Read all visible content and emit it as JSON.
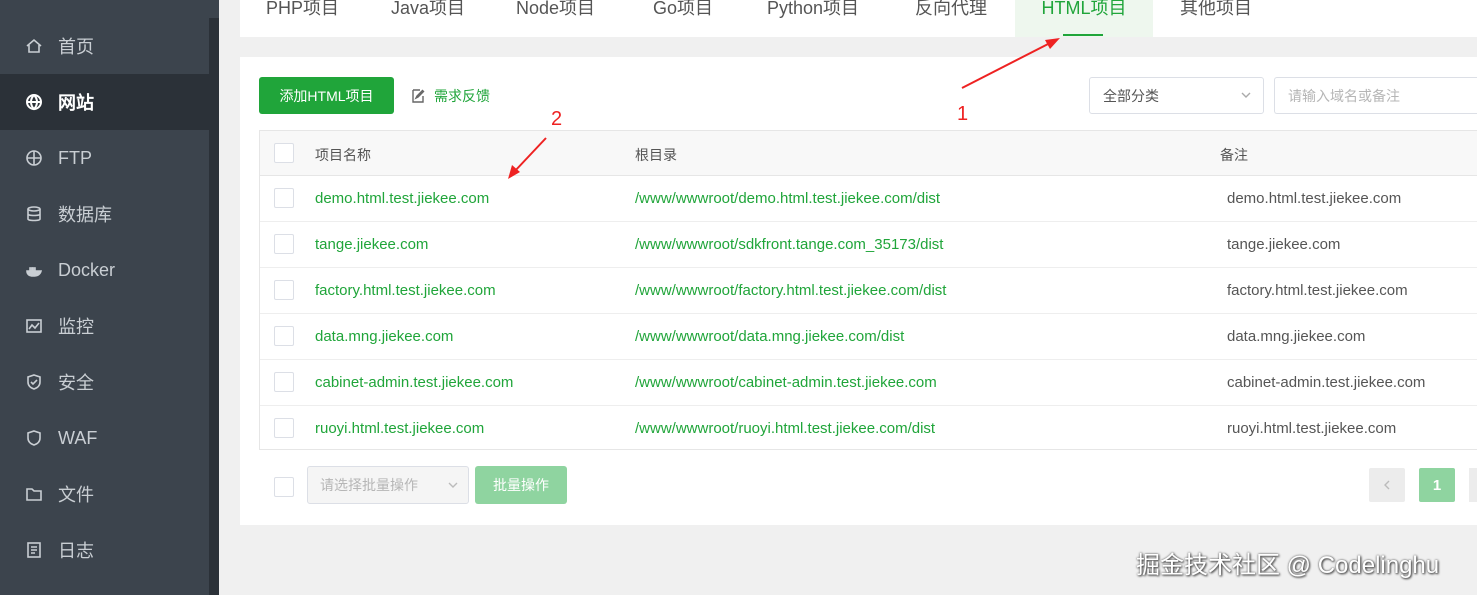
{
  "sidebar": {
    "items": [
      {
        "label": "首页",
        "icon": "home-icon"
      },
      {
        "label": "网站",
        "icon": "globe-icon",
        "active": true
      },
      {
        "label": "FTP",
        "icon": "ftp-globe-icon"
      },
      {
        "label": "数据库",
        "icon": "database-icon"
      },
      {
        "label": "Docker",
        "icon": "docker-icon"
      },
      {
        "label": "监控",
        "icon": "monitor-icon"
      },
      {
        "label": "安全",
        "icon": "shield-icon"
      },
      {
        "label": "WAF",
        "icon": "waf-shield-icon"
      },
      {
        "label": "文件",
        "icon": "folder-icon"
      },
      {
        "label": "日志",
        "icon": "log-icon"
      }
    ]
  },
  "tabs": [
    {
      "label": "PHP项目"
    },
    {
      "label": "Java项目"
    },
    {
      "label": "Node项目"
    },
    {
      "label": "Go项目"
    },
    {
      "label": "Python项目"
    },
    {
      "label": "反向代理"
    },
    {
      "label": "HTML项目",
      "active": true
    },
    {
      "label": "其他项目"
    }
  ],
  "toolbar": {
    "add_label": "添加HTML项目",
    "feedback_label": "需求反馈",
    "category_value": "全部分类",
    "search_placeholder": "请输入域名或备注"
  },
  "table": {
    "headers": {
      "name": "项目名称",
      "root": "根目录",
      "note": "备注"
    },
    "rows": [
      {
        "name": "demo.html.test.jiekee.com",
        "root": "/www/wwwroot/demo.html.test.jiekee.com/dist",
        "note": "demo.html.test.jiekee.com"
      },
      {
        "name": "tange.jiekee.com",
        "root": "/www/wwwroot/sdkfront.tange.com_35173/dist",
        "note": "tange.jiekee.com"
      },
      {
        "name": "factory.html.test.jiekee.com",
        "root": "/www/wwwroot/factory.html.test.jiekee.com/dist",
        "note": "factory.html.test.jiekee.com"
      },
      {
        "name": "data.mng.jiekee.com",
        "root": "/www/wwwroot/data.mng.jiekee.com/dist",
        "note": "data.mng.jiekee.com"
      },
      {
        "name": "cabinet-admin.test.jiekee.com",
        "root": "/www/wwwroot/cabinet-admin.test.jiekee.com",
        "note": "cabinet-admin.test.jiekee.com"
      },
      {
        "name": "ruoyi.html.test.jiekee.com",
        "root": "/www/wwwroot/ruoyi.html.test.jiekee.com/dist",
        "note": "ruoyi.html.test.jiekee.com"
      }
    ]
  },
  "footer": {
    "batch_placeholder": "请选择批量操作",
    "batch_button": "批量操作",
    "current_page": "1"
  },
  "annotations": {
    "one": "1",
    "two": "2"
  },
  "watermark": "掘金技术社区 @ Codelinghu",
  "colors": {
    "accent": "#20a53a",
    "sidebar": "#3c444d",
    "annotation": "#ee2222"
  }
}
